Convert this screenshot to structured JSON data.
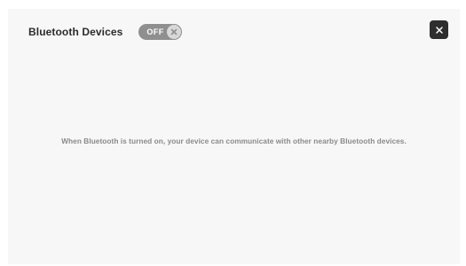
{
  "header": {
    "title": "Bluetooth Devices"
  },
  "toggle": {
    "state_label": "OFF",
    "knob_icon": "x-circle-icon",
    "color": "#8f8f8f"
  },
  "close_button": {
    "icon": "close-icon",
    "label": "×",
    "color": "#2e2e2e"
  },
  "body": {
    "message": "When Bluetooth is turned on, your device can communicate with other nearby Bluetooth devices."
  }
}
